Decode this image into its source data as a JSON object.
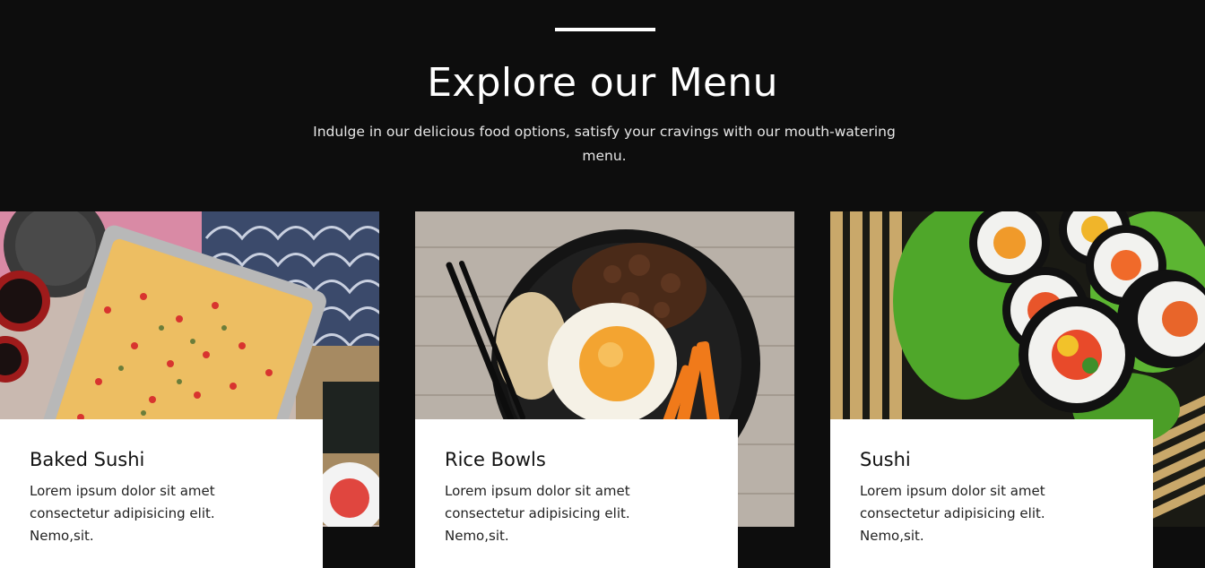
{
  "section": {
    "title": "Explore our Menu",
    "subtitle": "Indulge in our delicious food options, satisfy your cravings with our mouth-watering menu."
  },
  "menu_items": [
    {
      "title": "Baked Sushi",
      "description": "Lorem ipsum dolor sit amet consectetur adipisicing elit. Nemo,sit.",
      "image_icon": "baked-sushi-photo"
    },
    {
      "title": "Rice Bowls",
      "description": "Lorem ipsum dolor sit amet consectetur adipisicing elit. Nemo,sit.",
      "image_icon": "rice-bowl-photo"
    },
    {
      "title": "Sushi",
      "description": "Lorem ipsum dolor sit amet consectetur adipisicing elit. Nemo,sit.",
      "image_icon": "sushi-rolls-photo"
    }
  ],
  "colors": {
    "background": "#0d0d0d",
    "card_background": "#ffffff",
    "heading_text": "#ffffff",
    "card_title": "#111111"
  }
}
